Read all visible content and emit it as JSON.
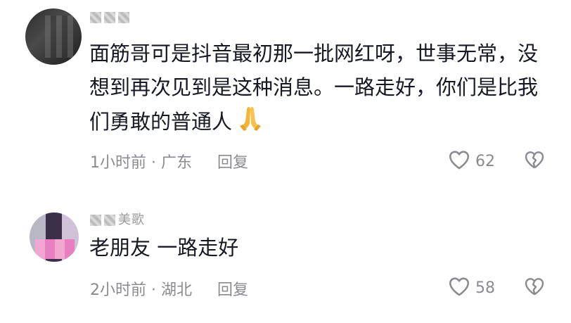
{
  "comments": [
    {
      "username": "▓ ▓ ▓",
      "text": "面筋哥可是抖音最初那一批网红呀，世事无常，没想到再次见到是这种消息。一路走好，你们是比我们勇敢的普通人",
      "emoji": "folded-hands-icon",
      "time": "1小时前",
      "location": "广东",
      "separator": " · ",
      "reply_label": "回复",
      "likes": "62"
    },
    {
      "username": "美歌",
      "text": "老朋友 一路走好",
      "time": "2小时前",
      "location": "湖北",
      "separator": " · ",
      "reply_label": "回复",
      "likes": "58"
    }
  ],
  "colors": {
    "text": "#161823",
    "meta": "#8a8b91",
    "background": "#ffffff"
  }
}
